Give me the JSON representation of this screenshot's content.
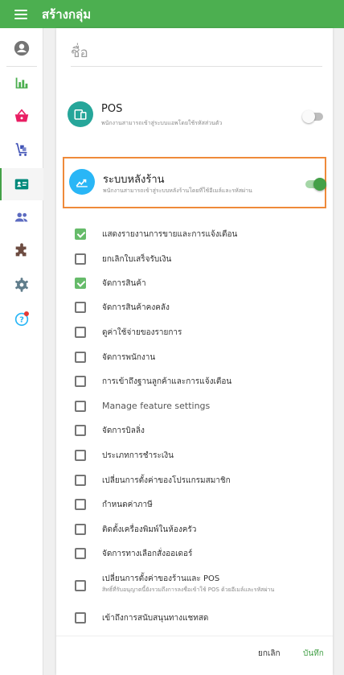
{
  "app": {
    "title": "สร้างกลุ่ม"
  },
  "colors": {
    "brand_green": "#4caf50",
    "accent_green": "#43a047",
    "highlight_border": "#ef8a3a",
    "pos_icon": "#26a69a",
    "backoffice_icon": "#29b6f6"
  },
  "sidebar": {
    "items": [
      {
        "icon": "account-circle-icon"
      },
      {
        "icon": "bar-chart-icon"
      },
      {
        "icon": "basket-icon"
      },
      {
        "icon": "inventory-cart-icon"
      },
      {
        "icon": "employee-card-icon",
        "active": true
      },
      {
        "icon": "customers-icon"
      },
      {
        "icon": "integrations-puzzle-icon"
      },
      {
        "icon": "settings-gear-icon"
      },
      {
        "icon": "help-icon",
        "badge": true
      }
    ]
  },
  "form": {
    "name_placeholder": "ชื่อ"
  },
  "features": {
    "pos": {
      "title": "POS",
      "description": "พนักงานสามารถเข้าสู่ระบบแอพโดยใช้รหัสส่วนตัว",
      "enabled": false
    },
    "backoffice": {
      "title": "ระบบหลังร้าน",
      "description": "พนักงานสามารถเข้าสู่ระบบหลังร้านโดยที่ใช้อีเมล์และรหัสผ่าน",
      "enabled": true
    }
  },
  "permissions": [
    {
      "label": "แสดงรายงานการขายและการแจ้งเตือน",
      "checked": true
    },
    {
      "label": "ยกเลิกใบเสร็จรับเงิน",
      "checked": false
    },
    {
      "label": "จัดการสินค้า",
      "checked": true
    },
    {
      "label": "จัดการสินค้าคงคลัง",
      "checked": false
    },
    {
      "label": "ดูค่าใช้จ่ายของรายการ",
      "checked": false
    },
    {
      "label": "จัดการพนักงาน",
      "checked": false
    },
    {
      "label": "การเข้าถึงฐานลูกค้าและการแจ้งเตือน",
      "checked": false
    },
    {
      "label": "Manage feature settings",
      "checked": false
    },
    {
      "label": "จัดการบิลลิ่ง",
      "checked": false
    },
    {
      "label": "ประเภทการชำระเงิน",
      "checked": false
    },
    {
      "label": "เปลี่ยนการตั้งค่าของโปรแกรมสมาชิก",
      "checked": false
    },
    {
      "label": "กำหนดค่าภาษี",
      "checked": false
    },
    {
      "label": "ติดตั้งเครื่องพิมพ์ในห้องครัว",
      "checked": false
    },
    {
      "label": "จัดการทางเลือกสั่งออเดอร์",
      "checked": false
    },
    {
      "label": "เปลี่ยนการตั้งค่าของร้านและ POS",
      "sublabel": "สิทธิ์ที่รับอนุญาตนี้ยังรวมถึงการลงชื่อเข้าใช้ POS ด้วยอีเมล์และรหัสผ่าน",
      "checked": false
    },
    {
      "label": "เข้าถึงการสนับสนุนทางแชทสด",
      "checked": false
    }
  ],
  "actions": {
    "cancel_label": "ยกเลิก",
    "save_label": "บันทึก"
  }
}
